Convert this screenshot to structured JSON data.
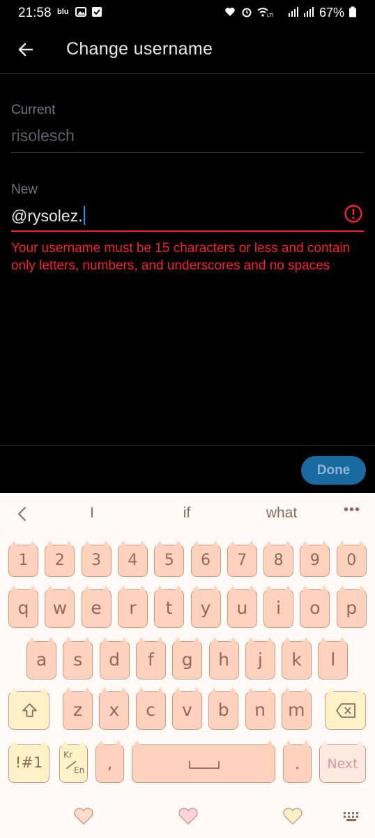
{
  "status_bar": {
    "time": "21:58",
    "carrier": "blu",
    "battery": "67%"
  },
  "header": {
    "title": "Change username"
  },
  "form": {
    "current_label": "Current",
    "current_value": "risolesch",
    "new_label": "New",
    "new_value": "@rysolez.",
    "error_message": "Your username must be 15 characters or less and contain only letters, numbers, and underscores and no spaces"
  },
  "footer": {
    "done_label": "Done"
  },
  "keyboard": {
    "suggestions": [
      "I",
      "if",
      "what"
    ],
    "more_label": "•••",
    "rows": [
      [
        "1",
        "2",
        "3",
        "4",
        "5",
        "6",
        "7",
        "8",
        "9",
        "0"
      ],
      [
        "q",
        "w",
        "e",
        "r",
        "t",
        "y",
        "u",
        "i",
        "o",
        "p"
      ],
      [
        "a",
        "s",
        "d",
        "f",
        "g",
        "h",
        "j",
        "k",
        "l"
      ],
      [
        "z",
        "x",
        "c",
        "v",
        "b",
        "n",
        "m"
      ]
    ],
    "symbols_label": "!#1",
    "lang_top": "Kr",
    "lang_bottom": "En",
    "comma_label": ",",
    "period_label": ".",
    "next_label": "Next"
  },
  "colors": {
    "accent": "#1d9bf0",
    "error": "#f4212e",
    "key_fill": "#ffd2bd",
    "key_border": "#c69a86",
    "key_text": "#8d6b5b"
  }
}
